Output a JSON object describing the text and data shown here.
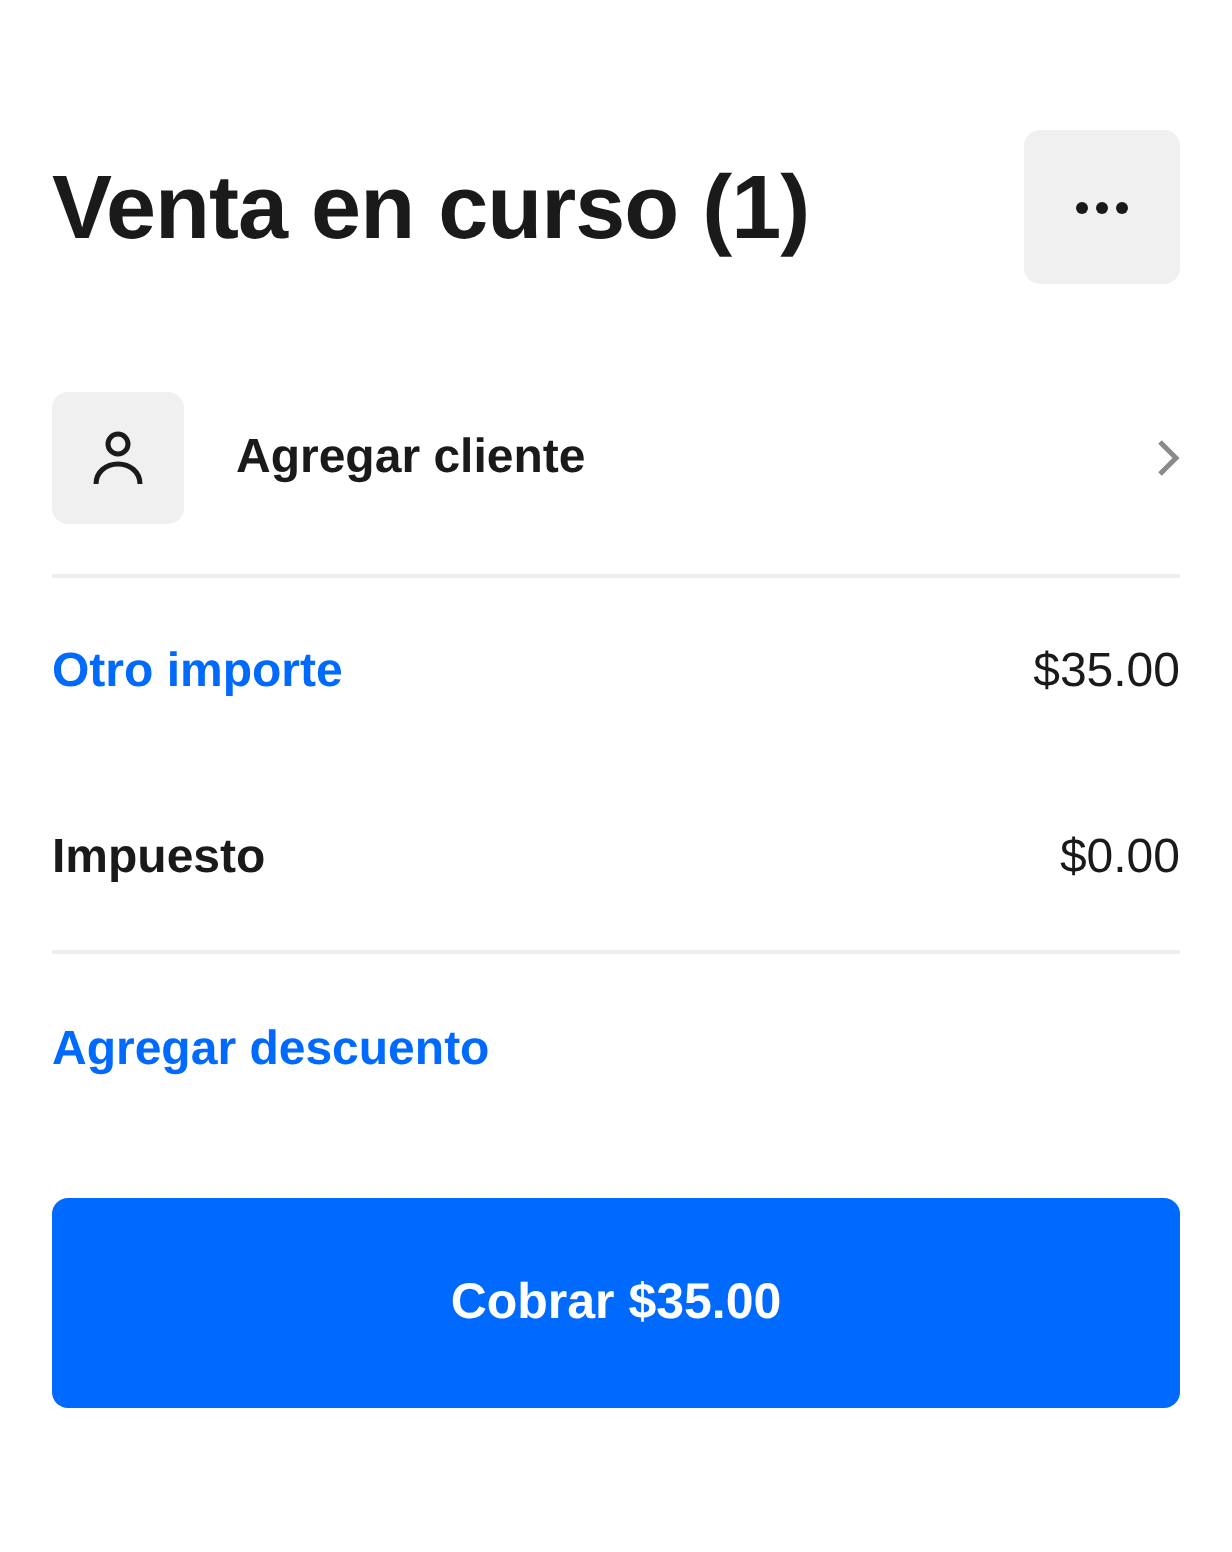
{
  "header": {
    "title": "Venta en curso (1)"
  },
  "customer": {
    "label": "Agregar cliente"
  },
  "lines": [
    {
      "label": "Otro importe",
      "amount": "$35.00",
      "kind": "link"
    },
    {
      "label": "Impuesto",
      "amount": "$0.00",
      "kind": "plain"
    }
  ],
  "discount": {
    "label": "Agregar descuento"
  },
  "charge_button": {
    "label": "Cobrar $35.00"
  }
}
